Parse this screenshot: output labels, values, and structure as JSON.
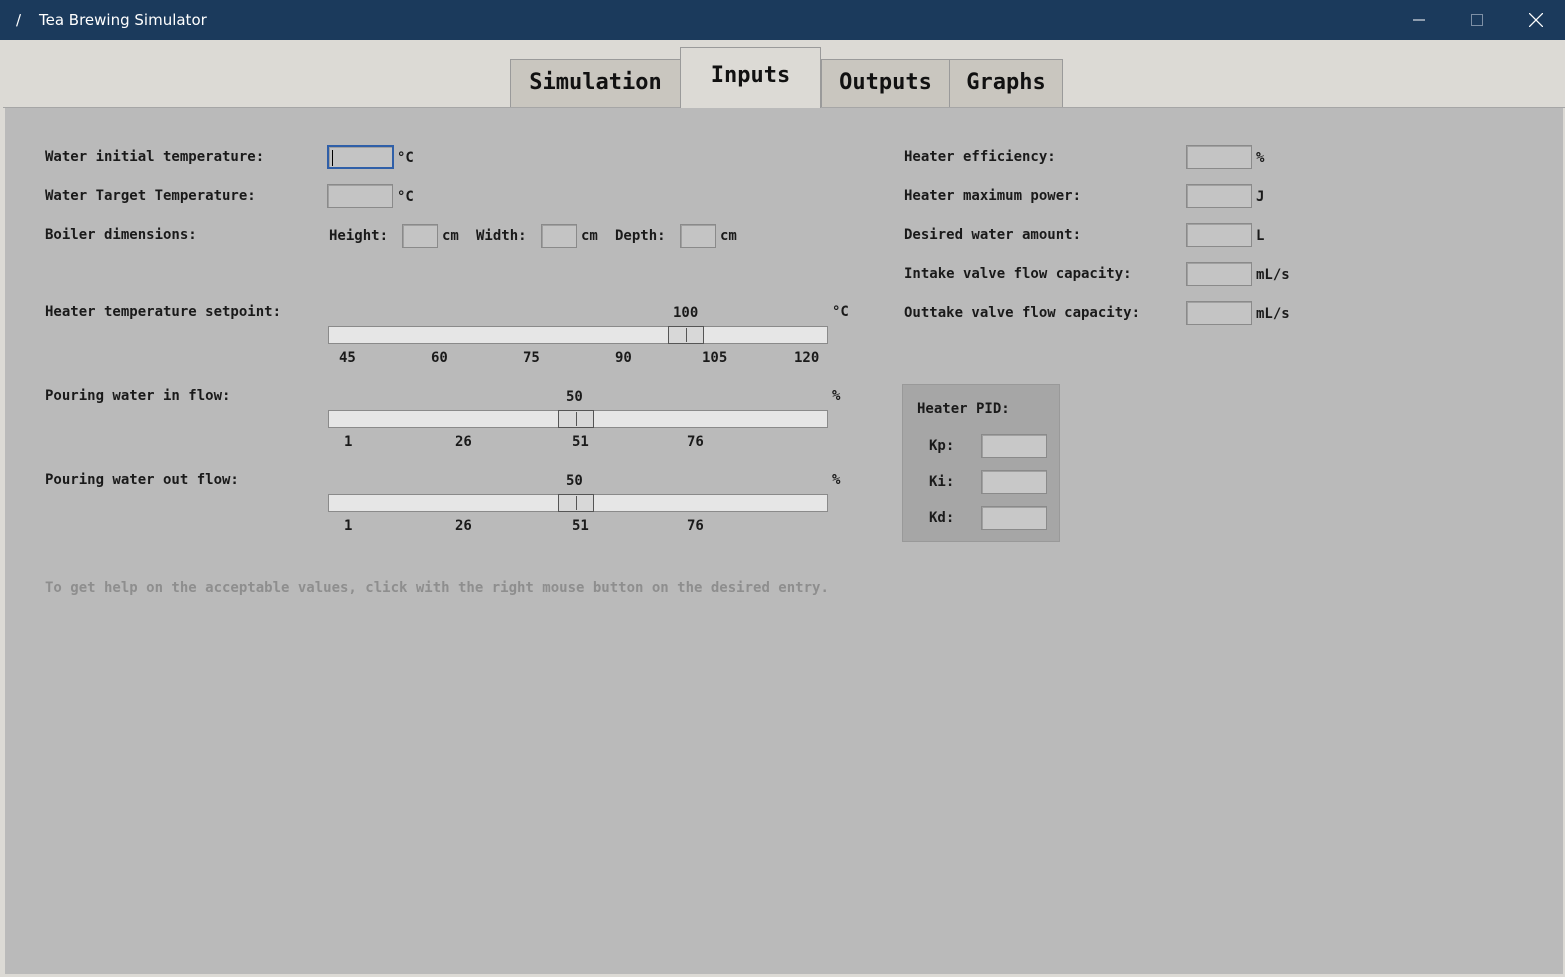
{
  "window": {
    "title": "Tea Brewing Simulator"
  },
  "tabs": [
    {
      "label": "Simulation",
      "active": false
    },
    {
      "label": "Inputs",
      "active": true
    },
    {
      "label": "Outputs",
      "active": false
    },
    {
      "label": "Graphs",
      "active": false
    }
  ],
  "left": {
    "water_initial_temp": {
      "label": "Water initial temperature:",
      "unit": "°C",
      "value": ""
    },
    "water_target_temp": {
      "label": "Water Target Temperature:",
      "unit": "°C",
      "value": ""
    },
    "boiler": {
      "label": "Boiler dimensions:",
      "height_label": "Height:",
      "width_label": "Width:",
      "depth_label": "Depth:",
      "unit": "cm",
      "height": "",
      "width": "",
      "depth": ""
    },
    "heater_setpoint": {
      "label": "Heater temperature setpoint:",
      "unit": "°C",
      "value": "100",
      "min": 45,
      "max": 120,
      "ticks": [
        "45",
        "60",
        "75",
        "90",
        "105",
        "120"
      ]
    },
    "flow_in": {
      "label": "Pouring water in flow:",
      "unit": "%",
      "value": "50",
      "min": 1,
      "max": 100,
      "ticks": [
        "1",
        "26",
        "51",
        "76"
      ]
    },
    "flow_out": {
      "label": "Pouring water out flow:",
      "unit": "%",
      "value": "50",
      "min": 1,
      "max": 100,
      "ticks": [
        "1",
        "26",
        "51",
        "76"
      ]
    }
  },
  "right": {
    "heater_efficiency": {
      "label": "Heater efficiency:",
      "unit": "%",
      "value": ""
    },
    "heater_max_power": {
      "label": "Heater maximum power:",
      "unit": "J",
      "value": ""
    },
    "desired_water": {
      "label": "Desired water amount:",
      "unit": "L",
      "value": ""
    },
    "intake_valve": {
      "label": "Intake valve flow capacity:",
      "unit": "mL/s",
      "value": ""
    },
    "outtake_valve": {
      "label": "Outtake valve flow capacity:",
      "unit": "mL/s",
      "value": ""
    }
  },
  "pid": {
    "title": "Heater PID:",
    "kp_label": "Kp:",
    "ki_label": "Ki:",
    "kd_label": "Kd:",
    "kp": "",
    "ki": "",
    "kd": ""
  },
  "help_text": "To get help on the acceptable values, click with the right mouse button on the desired entry."
}
